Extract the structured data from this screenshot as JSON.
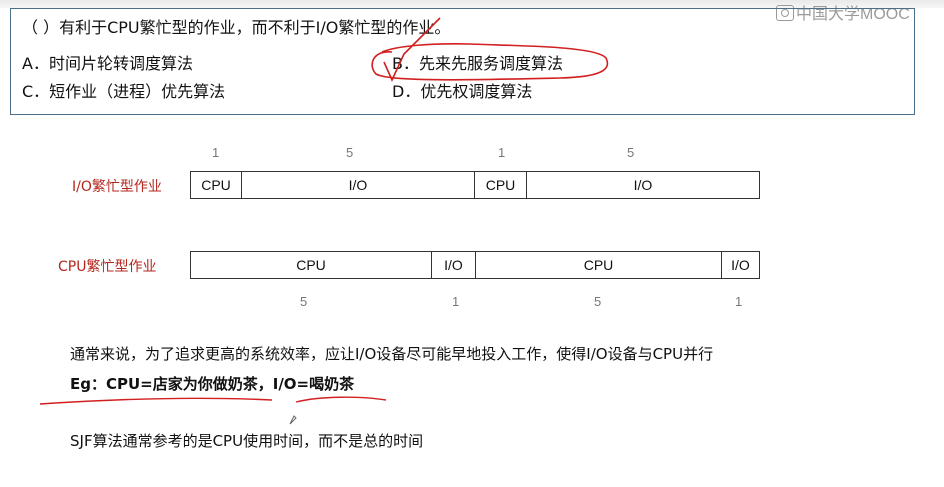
{
  "watermark": {
    "text": "中国大学MOOC"
  },
  "question": {
    "stem": "（ ）有利于CPU繁忙型的作业，而不利于I/O繁忙型的作业。",
    "options": [
      {
        "key": "A",
        "text": "A．时间片轮转调度算法"
      },
      {
        "key": "B",
        "text": "B．先来先服务调度算法"
      },
      {
        "key": "C",
        "text": "C．短作业（进程）优先算法"
      },
      {
        "key": "D",
        "text": "D．优先权调度算法"
      }
    ]
  },
  "diagram": {
    "io_row": {
      "label": "I/O繁忙型作业",
      "segments": [
        {
          "name": "CPU",
          "duration": 1
        },
        {
          "name": "I/O",
          "duration": 5
        },
        {
          "name": "CPU",
          "duration": 1
        },
        {
          "name": "I/O",
          "duration": 5
        }
      ],
      "duration_labels": [
        "1",
        "5",
        "1",
        "5"
      ]
    },
    "cpu_row": {
      "label": "CPU繁忙型作业",
      "segments": [
        {
          "name": "CPU",
          "duration": 5
        },
        {
          "name": "I/O",
          "duration": 1
        },
        {
          "name": "CPU",
          "duration": 5
        },
        {
          "name": "I/O",
          "duration": 1
        }
      ],
      "duration_labels": [
        "5",
        "1",
        "5",
        "1"
      ]
    }
  },
  "notes": {
    "line1": "通常来说，为了追求更高的系统效率，应让I/O设备尽可能早地投入工作，使得I/O设备与CPU并行",
    "line2": "Eg：CPU=店家为你做奶茶，I/O=喝奶茶",
    "line3": "SJF算法通常参考的是CPU使用时间，而不是总的时间"
  },
  "colors": {
    "annotation": "#d21f1f",
    "label": "#b3261e",
    "frame": "#4a6f8a"
  }
}
